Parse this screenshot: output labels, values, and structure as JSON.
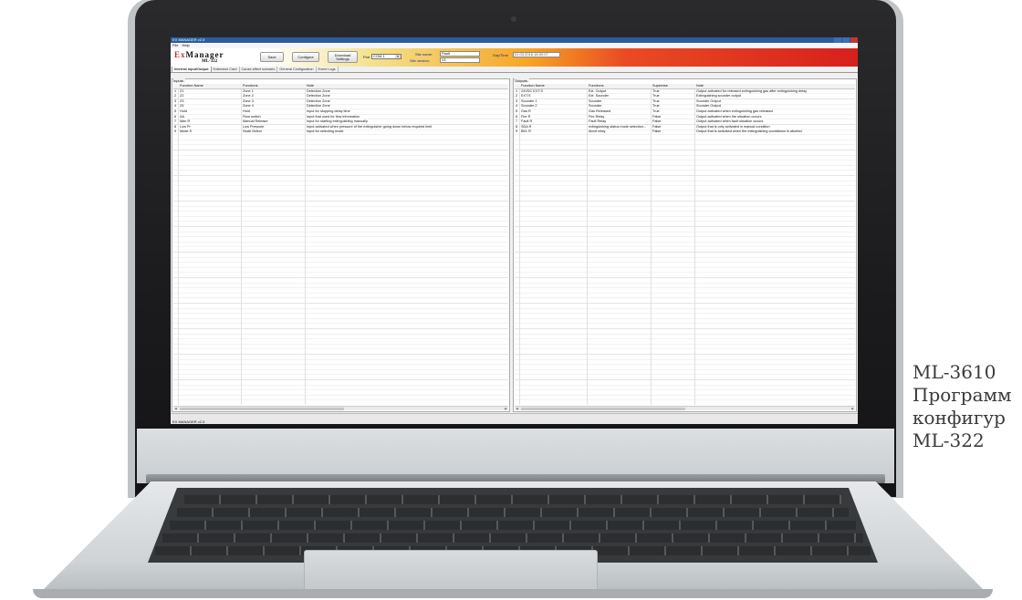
{
  "caption": {
    "line1": "ML-3610",
    "line2": "Программ",
    "line3": "конфигур",
    "line4": "ML-322"
  },
  "app": {
    "window_title": "EX MANAGER v2.5",
    "menu": [
      "File",
      "Help"
    ],
    "logo_text": "ExManager",
    "model": "ML-322",
    "toolbar": {
      "save_label": "Save",
      "configure_label": "Configure",
      "download_label": "Download Settings",
      "port_label": "Port",
      "port_value": "COM 1",
      "site_name_label": "Site name:",
      "site_name_value": "Paolt",
      "site_version_label": "Site version:",
      "site_version_value": "V1",
      "datetime_label": "Day/Time",
      "datetime_value": "01.03.2016 18:00:07"
    },
    "tabs": [
      "Internal Input/Output",
      "Extension Card",
      "Cause-effect scenario",
      "General Configuration",
      "Event Logs"
    ],
    "inputs": {
      "title": "Inputs",
      "columns": [
        "Function Name",
        "Functions",
        "Note"
      ],
      "rows": [
        [
          "1",
          "Z1",
          "Zone 1",
          "Detection Zone"
        ],
        [
          "2",
          "Z2",
          "Zone 2",
          "Detection Zone"
        ],
        [
          "3",
          "Z3",
          "Zone 3",
          "Detection Zone"
        ],
        [
          "4",
          "Z4",
          "Zone 4",
          "Detection Zone"
        ],
        [
          "5",
          "Hold",
          "Hold",
          "Input for stopping delay time"
        ],
        [
          "6",
          "AA",
          "Flow switch",
          "Input that used for flow information"
        ],
        [
          "7",
          "Man R",
          "Manual Release",
          "Input for starting extinguishing manually"
        ],
        [
          "8",
          "Low Pr",
          "Low Pressure",
          "Input activated when pressure of fire extinguisher going down below required limit"
        ],
        [
          "9",
          "Mode S",
          "Node Select",
          "Input for selecting mode"
        ]
      ]
    },
    "outputs": {
      "title": "Outputs",
      "columns": [
        "Function Name",
        "Functions",
        "Supervise",
        "Note"
      ],
      "rows": [
        [
          "1",
          "24VDC EXT.S",
          "Ext. Output",
          "True",
          "Output activated for released extinguishing gas after extinguishing delay"
        ],
        [
          "2",
          "EXT.S",
          "Ext. Sounder",
          "True",
          "Extinguishing sounder output"
        ],
        [
          "3",
          "Sounder 1",
          "Sounder",
          "True",
          "Sounder Output"
        ],
        [
          "4",
          "Sounder 2",
          "Sounder",
          "True",
          "Sounder Output"
        ],
        [
          "5",
          "Gas R",
          "Gas Released",
          "True",
          "Output activated when extinguishing gas released"
        ],
        [
          "6",
          "Fire R",
          "Fire Relay",
          "False",
          "Output activated when fire situation occurs"
        ],
        [
          "7",
          "Fault R",
          "Fault Relay",
          "False",
          "Output activated when fault situation occurs"
        ],
        [
          "8",
          "SDA R",
          "extinguishing status mode selection...",
          "False",
          "Output that is only activated in manual condition"
        ],
        [
          "9",
          "BKL R",
          "Abort relay",
          "False",
          "Output that is activated when the extinguishing countdown is aborted"
        ]
      ]
    },
    "status_text": "EX MANAGER v2.5"
  }
}
